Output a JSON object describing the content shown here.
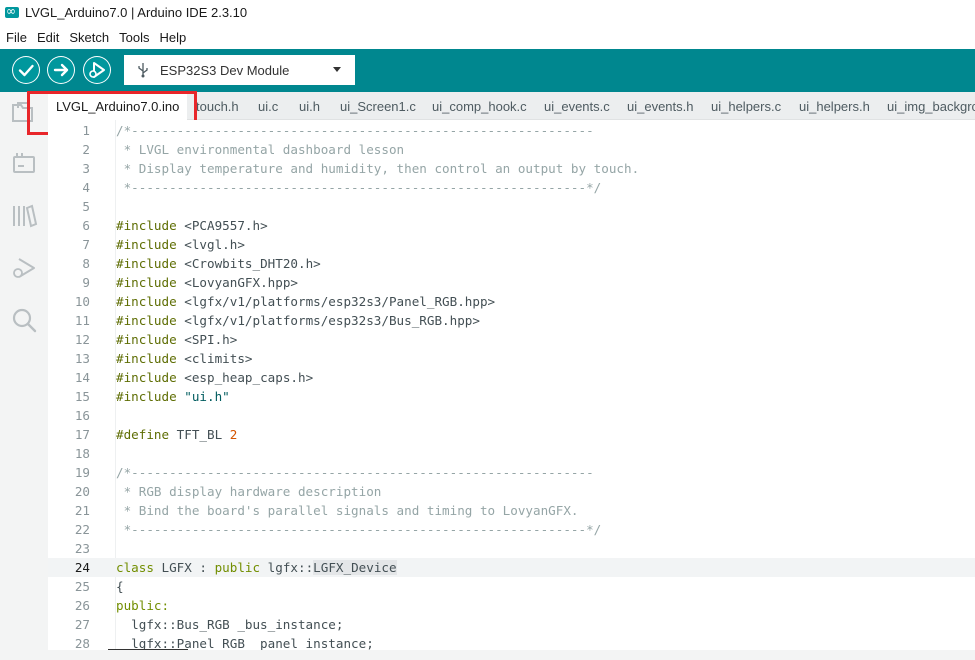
{
  "window": {
    "title": "LVGL_Arduino7.0 | Arduino IDE 2.3.10"
  },
  "menu": [
    "File",
    "Edit",
    "Sketch",
    "Tools",
    "Help"
  ],
  "toolbar": {
    "board": "ESP32S3 Dev Module"
  },
  "colors": {
    "accent": "#00878f",
    "annotation": "#e8262a"
  },
  "tabs": [
    "LVGL_Arduino7.0.ino",
    "touch.h",
    "ui.c",
    "ui.h",
    "ui_Screen1.c",
    "ui_comp_hook.c",
    "ui_events.c",
    "ui_events.h",
    "ui_helpers.c",
    "ui_helpers.h",
    "ui_img_backgrc"
  ],
  "active_tab": 0,
  "editor": {
    "current_line": 24,
    "lines": [
      {
        "n": "1",
        "parts": [
          [
            "comment",
            "/*-------------------------------------------------------------"
          ]
        ]
      },
      {
        "n": "2",
        "parts": [
          [
            "comment",
            " * LVGL environmental dashboard lesson"
          ]
        ]
      },
      {
        "n": "3",
        "parts": [
          [
            "comment",
            " * Display temperature and humidity, then control an output by touch."
          ]
        ]
      },
      {
        "n": "4",
        "parts": [
          [
            "comment",
            " *------------------------------------------------------------*/"
          ]
        ]
      },
      {
        "n": "5",
        "parts": []
      },
      {
        "n": "6",
        "parts": [
          [
            "include",
            "#include "
          ],
          [
            "plain",
            "<PCA9557.h>"
          ]
        ]
      },
      {
        "n": "7",
        "parts": [
          [
            "include",
            "#include "
          ],
          [
            "plain",
            "<lvgl.h>"
          ]
        ]
      },
      {
        "n": "8",
        "parts": [
          [
            "include",
            "#include "
          ],
          [
            "plain",
            "<Crowbits_DHT20.h>"
          ]
        ]
      },
      {
        "n": "9",
        "parts": [
          [
            "include",
            "#include "
          ],
          [
            "plain",
            "<LovyanGFX.hpp>"
          ]
        ]
      },
      {
        "n": "10",
        "parts": [
          [
            "include",
            "#include "
          ],
          [
            "plain",
            "<lgfx/v1/platforms/esp32s3/Panel_RGB.hpp>"
          ]
        ]
      },
      {
        "n": "11",
        "parts": [
          [
            "include",
            "#include "
          ],
          [
            "plain",
            "<lgfx/v1/platforms/esp32s3/Bus_RGB.hpp>"
          ]
        ]
      },
      {
        "n": "12",
        "parts": [
          [
            "include",
            "#include "
          ],
          [
            "plain",
            "<SPI.h>"
          ]
        ]
      },
      {
        "n": "13",
        "parts": [
          [
            "include",
            "#include "
          ],
          [
            "plain",
            "<climits>"
          ]
        ]
      },
      {
        "n": "14",
        "parts": [
          [
            "include",
            "#include "
          ],
          [
            "plain",
            "<esp_heap_caps.h>"
          ]
        ]
      },
      {
        "n": "15",
        "parts": [
          [
            "include",
            "#include "
          ],
          [
            "str",
            "\"ui.h\""
          ]
        ]
      },
      {
        "n": "16",
        "parts": []
      },
      {
        "n": "17",
        "parts": [
          [
            "include",
            "#define "
          ],
          [
            "plain",
            "TFT_BL "
          ],
          [
            "const",
            "2"
          ]
        ]
      },
      {
        "n": "18",
        "parts": []
      },
      {
        "n": "19",
        "parts": [
          [
            "comment",
            "/*-------------------------------------------------------------"
          ]
        ]
      },
      {
        "n": "20",
        "parts": [
          [
            "comment",
            " * RGB display hardware description"
          ]
        ]
      },
      {
        "n": "21",
        "parts": [
          [
            "comment",
            " * Bind the board's parallel signals and timing to LovyanGFX."
          ]
        ]
      },
      {
        "n": "22",
        "parts": [
          [
            "comment",
            " *------------------------------------------------------------*/"
          ]
        ]
      },
      {
        "n": "23",
        "parts": []
      },
      {
        "n": "24",
        "parts": [
          [
            "kw",
            "class "
          ],
          [
            "plain",
            "LGFX : "
          ],
          [
            "kw",
            "public "
          ],
          [
            "plain",
            "lgfx::"
          ],
          [
            "sel",
            "LGFX_Device"
          ]
        ]
      },
      {
        "n": "25",
        "parts": [
          [
            "plain",
            "{"
          ]
        ]
      },
      {
        "n": "26",
        "parts": [
          [
            "kw",
            "public:"
          ]
        ]
      },
      {
        "n": "27",
        "parts": [
          [
            "plain",
            "  lgfx::Bus_RGB _bus_instance;"
          ]
        ]
      },
      {
        "n": "28",
        "parts": [
          [
            "plain",
            "  lgfx::Panel_RGB _panel_instance;"
          ]
        ]
      }
    ]
  }
}
